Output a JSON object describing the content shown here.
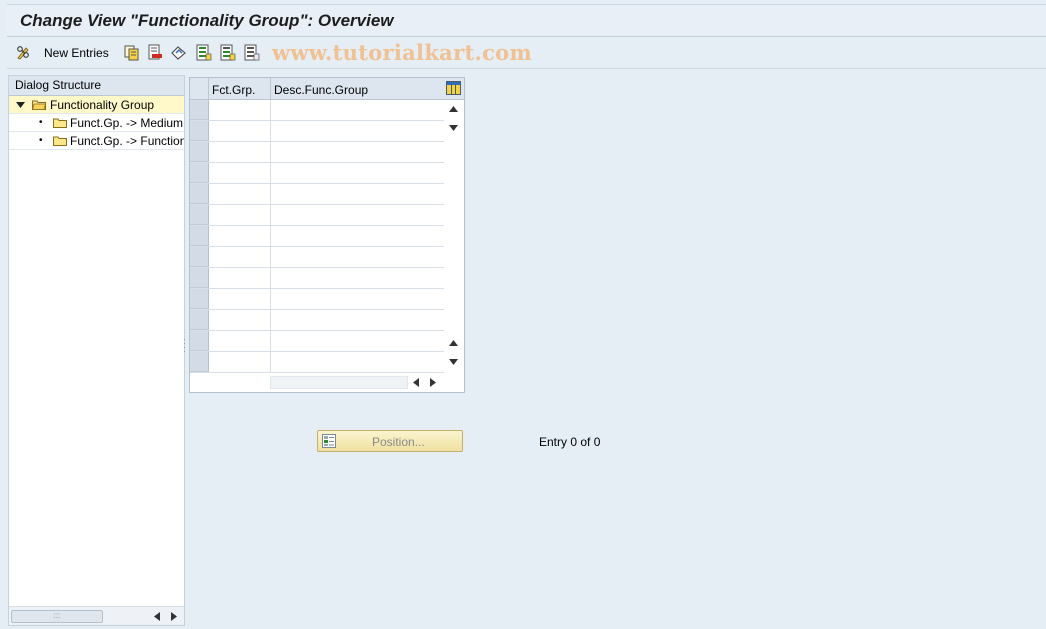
{
  "title": "Change View \"Functionality Group\": Overview",
  "toolbar": {
    "new_entries_label": "New Entries",
    "watermark": "www.tutorialkart.com",
    "icons": [
      "pencil-glasses-icon",
      "copy-icon",
      "delete-icon",
      "undo-icon",
      "select-all-icon",
      "select-block-icon",
      "deselect-all-icon"
    ]
  },
  "dialog_structure": {
    "header": "Dialog Structure",
    "items": [
      {
        "label": "Functionality Group",
        "expanded": true,
        "selected": true
      },
      {
        "label": "Funct.Gp. -> Medium",
        "expanded": false,
        "selected": false
      },
      {
        "label": "Funct.Gp. -> Function",
        "expanded": false,
        "selected": false
      }
    ]
  },
  "table": {
    "columns": [
      "Fct.Grp.",
      "Desc.Func.Group"
    ],
    "row_count": 13,
    "rows": []
  },
  "position_button_label": "Position...",
  "entry_info": "Entry 0 of 0",
  "colors": {
    "background": "#e5edf5",
    "selected_tree_item": "#fff8c8",
    "watermark": "#f0c193",
    "position_button": "#f6ebb8"
  }
}
